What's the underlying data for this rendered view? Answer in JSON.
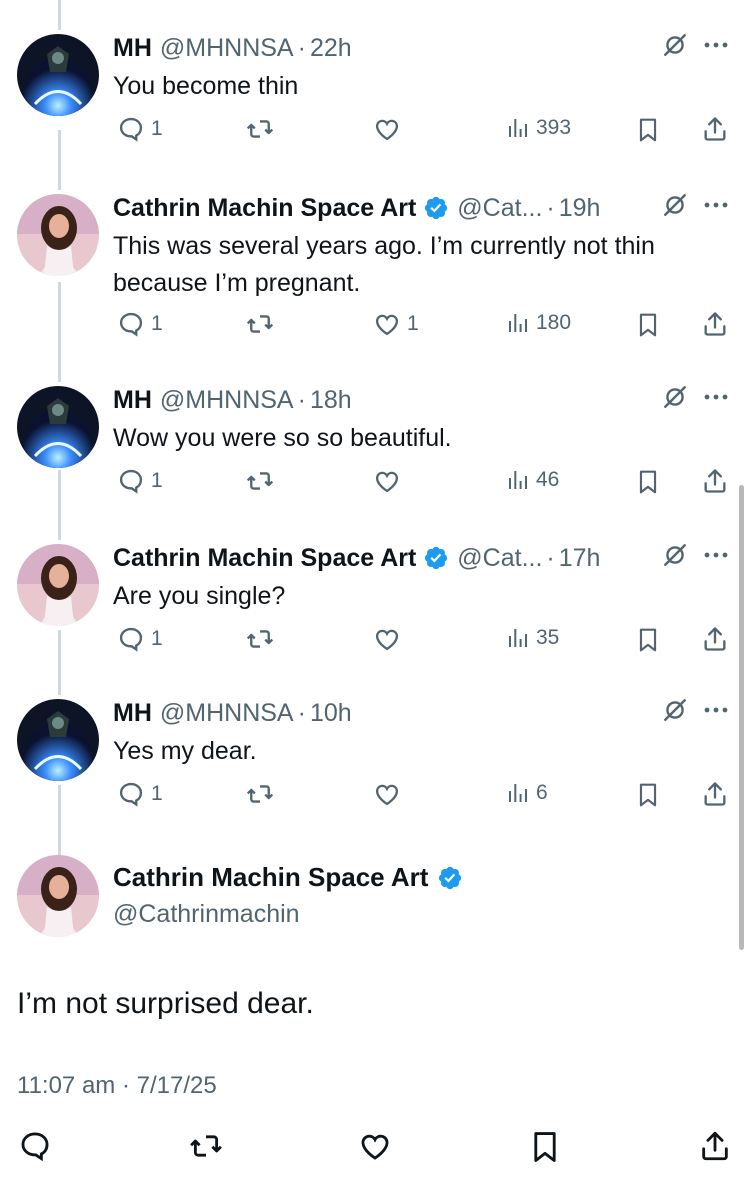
{
  "accent": "#1d9bf0",
  "replies": [
    {
      "name": "MH",
      "handle": "@MHNNSA",
      "time": "22h",
      "text": "You become thin",
      "reply_count": "1",
      "like_count": "",
      "view_count": "393",
      "verified": false,
      "avatar": "mh"
    },
    {
      "name": "Cathrin Machin Space Art",
      "handle": "@Cat...",
      "time": "19h",
      "text": "This was several years ago. I’m currently not thin because I’m pregnant.",
      "reply_count": "1",
      "like_count": "1",
      "view_count": "180",
      "verified": true,
      "avatar": "cathrin"
    },
    {
      "name": "MH",
      "handle": "@MHNNSA",
      "time": "18h",
      "text": "Wow you were so so beautiful.",
      "reply_count": "1",
      "like_count": "",
      "view_count": "46",
      "verified": false,
      "avatar": "mh"
    },
    {
      "name": "Cathrin Machin Space Art",
      "handle": "@Cat...",
      "time": "17h",
      "text": "Are you single?",
      "reply_count": "1",
      "like_count": "",
      "view_count": "35",
      "verified": true,
      "avatar": "cathrin"
    },
    {
      "name": "MH",
      "handle": "@MHNNSA",
      "time": "10h",
      "text": "Yes my dear.",
      "reply_count": "1",
      "like_count": "",
      "view_count": "6",
      "verified": false,
      "avatar": "mh"
    }
  ],
  "focused": {
    "name": "Cathrin Machin Space Art",
    "handle": "@Cathrinmachin",
    "text": "I’m not surprised dear.",
    "timestamp": "11:07 am · 7/17/25"
  },
  "icons": {
    "reply": "reply-icon",
    "retweet": "retweet-icon",
    "like": "like-icon",
    "views": "views-icon",
    "bookmark": "bookmark-icon",
    "share": "share-icon",
    "grok": "grok-icon",
    "more": "more-icon",
    "verified": "verified-badge-icon"
  }
}
